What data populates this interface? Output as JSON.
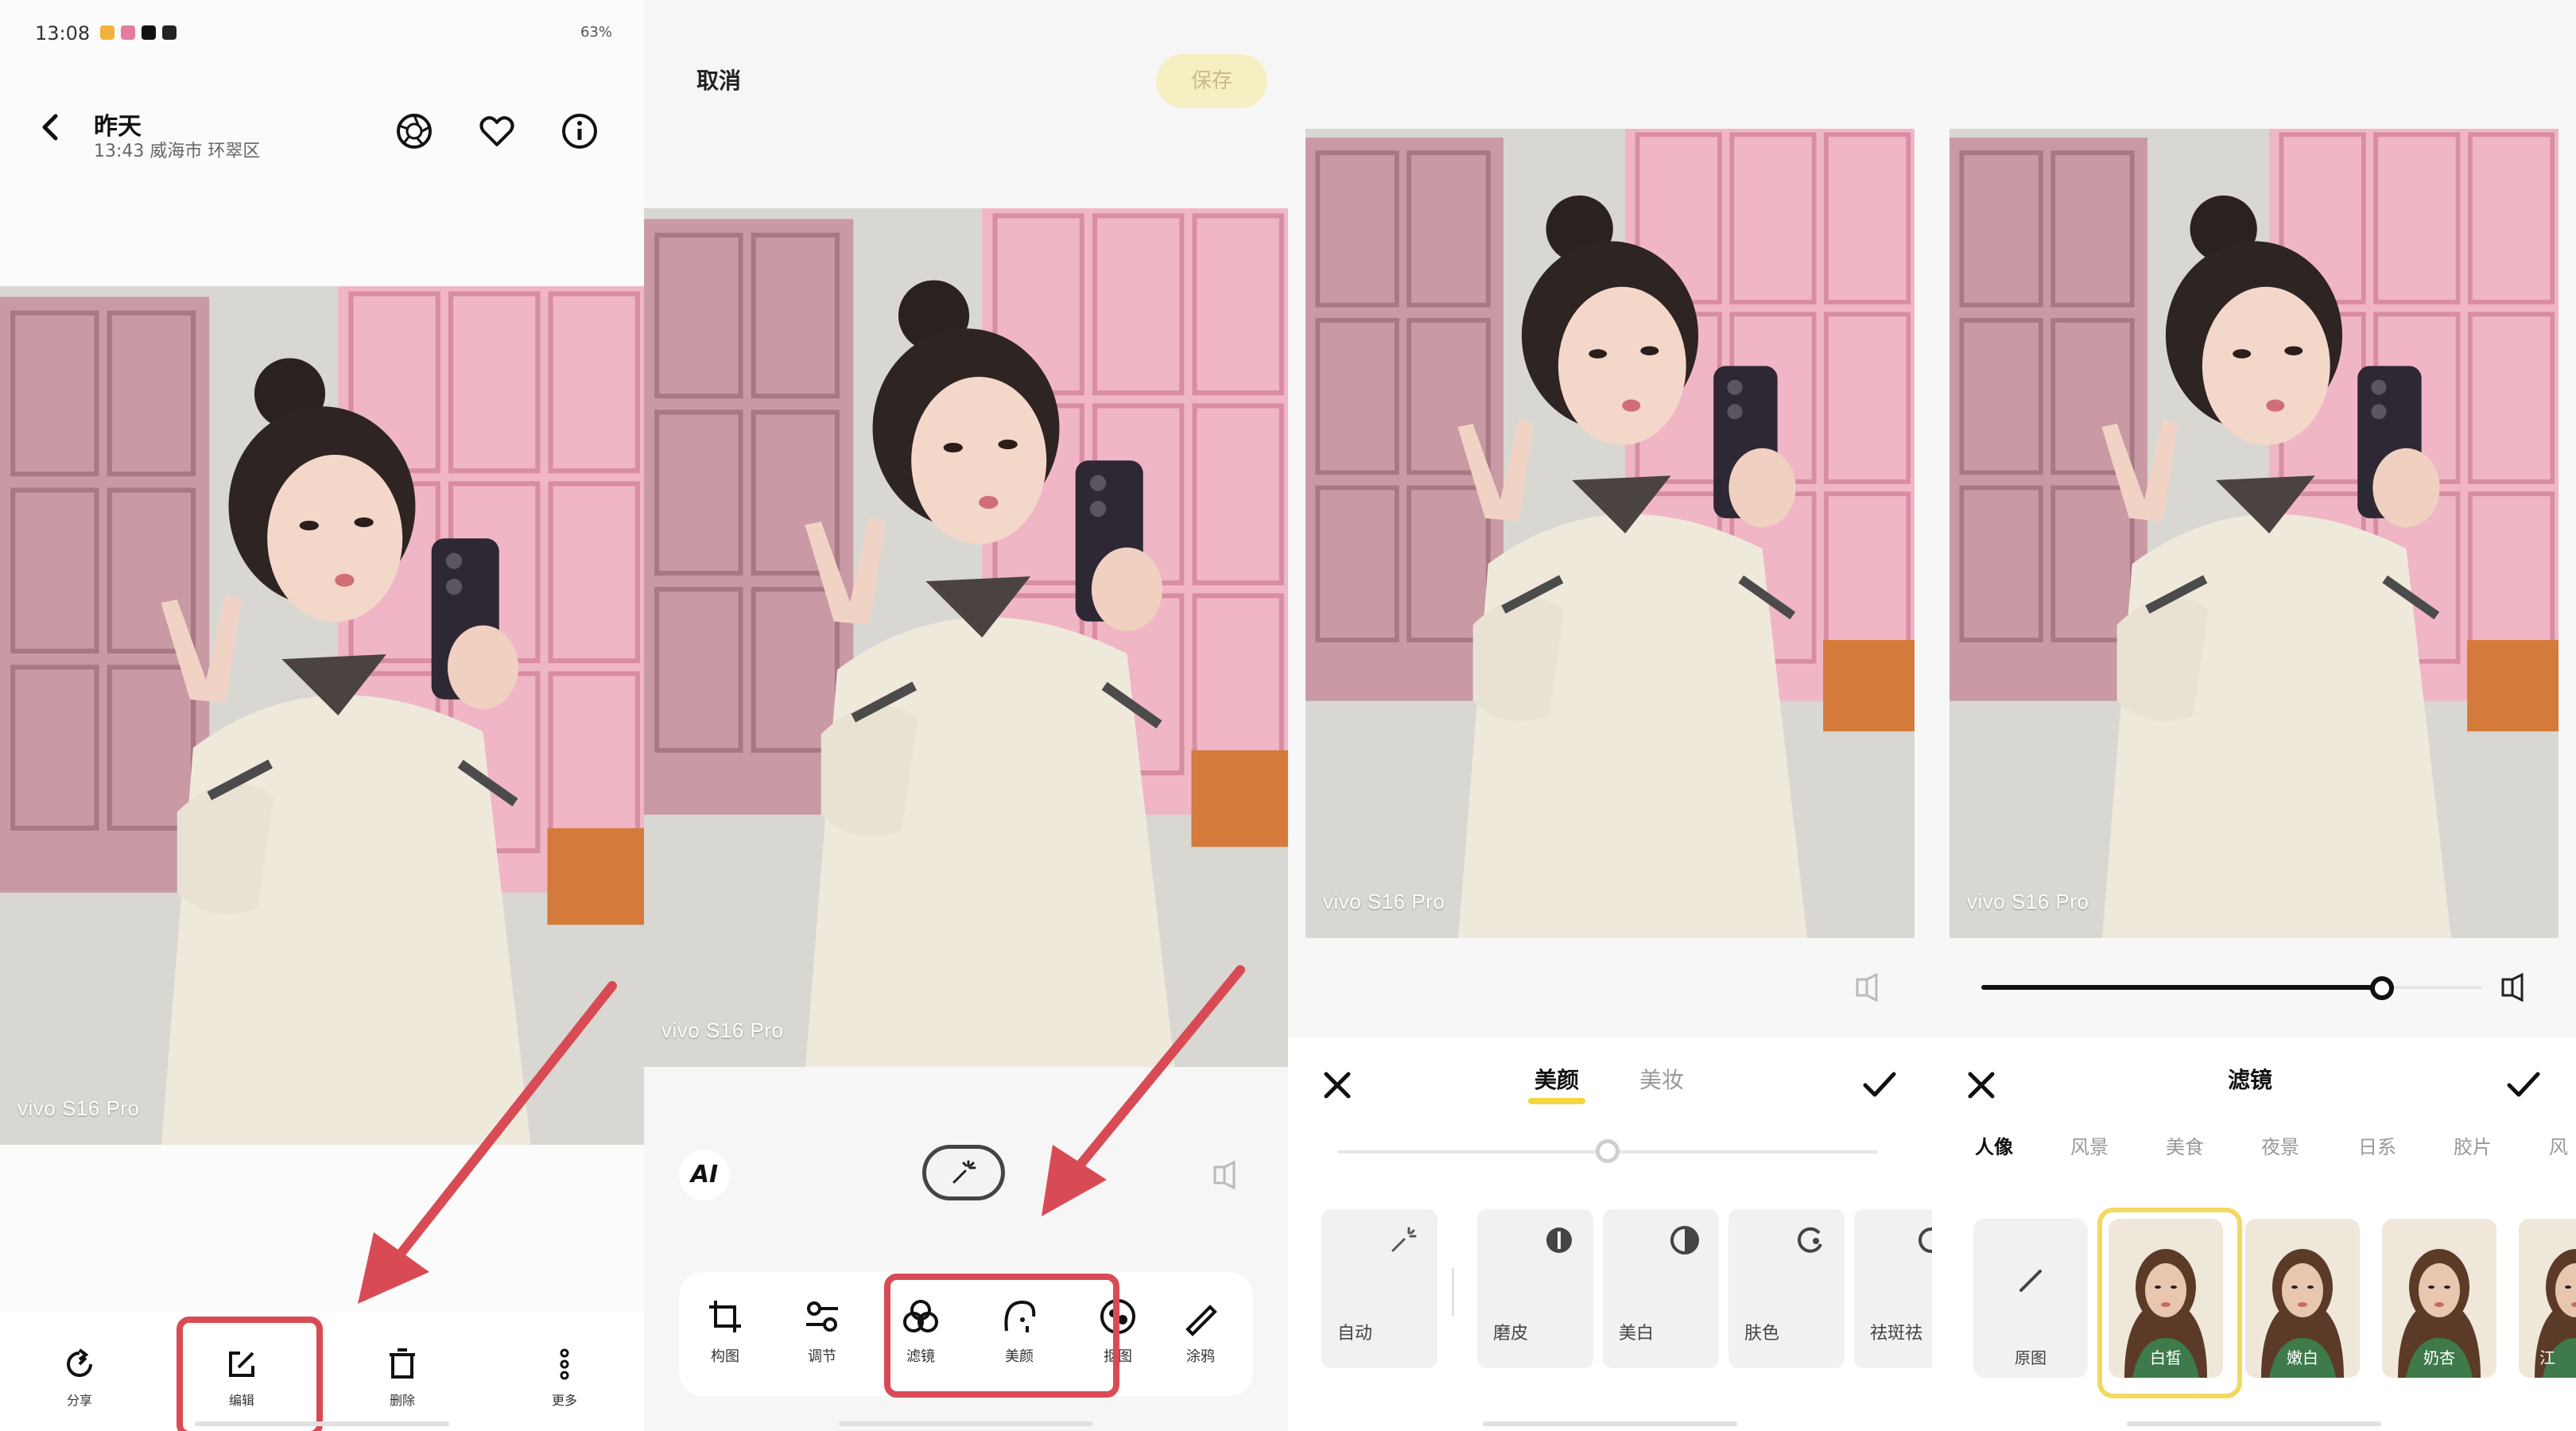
{
  "colors": {
    "accent": "#f4d640",
    "highlight_red": "#d94b54",
    "save_bg": "#f6efc2"
  },
  "watermark": "vivo S16 Pro",
  "panel1": {
    "status_time": "13:08",
    "status_right": "63%",
    "title": "昨天",
    "subtitle": "13:43 威海市 环翠区",
    "icons": [
      "back-icon",
      "aperture-icon",
      "heart-icon",
      "info-icon"
    ],
    "bottom_bar": [
      {
        "label": "分享",
        "icon": "share-icon"
      },
      {
        "label": "编辑",
        "icon": "edit-icon"
      },
      {
        "label": "删除",
        "icon": "delete-icon"
      },
      {
        "label": "更多",
        "icon": "more-icon"
      }
    ]
  },
  "panel2": {
    "cancel": "取消",
    "save": "保存",
    "ai": "AI",
    "tools": [
      {
        "label": "构图",
        "icon": "crop-icon"
      },
      {
        "label": "调节",
        "icon": "adjust-icon"
      },
      {
        "label": "滤镜",
        "icon": "filter-icon"
      },
      {
        "label": "美颜",
        "icon": "beauty-icon"
      },
      {
        "label": "抠图",
        "icon": "cutout-icon"
      },
      {
        "label": "涂鸦",
        "icon": "doodle-icon"
      }
    ]
  },
  "panel3": {
    "tabs": [
      "美颜",
      "美妆"
    ],
    "options": [
      {
        "label": "自动",
        "icon": "magic-wand-icon"
      },
      {
        "label": "磨皮",
        "icon": "smooth-icon"
      },
      {
        "label": "美白",
        "icon": "whiten-icon"
      },
      {
        "label": "肤色",
        "icon": "skin-tone-icon"
      },
      {
        "label": "祛斑祛",
        "icon": "blemish-icon"
      }
    ],
    "slider_value": 0.5
  },
  "panel4": {
    "title": "滤镜",
    "categories": [
      "人像",
      "风景",
      "美食",
      "夜景",
      "日系",
      "胶片",
      "风"
    ],
    "filters": [
      {
        "label": "原图"
      },
      {
        "label": "白皙"
      },
      {
        "label": "嫩白"
      },
      {
        "label": "奶杏"
      },
      {
        "label": "江"
      }
    ],
    "slider_value": 0.8
  }
}
